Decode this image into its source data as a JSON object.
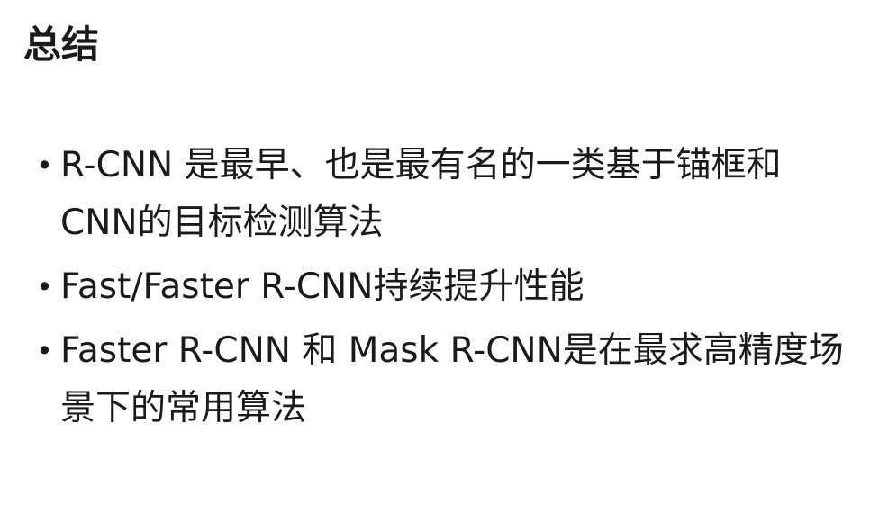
{
  "slide": {
    "title": "总结",
    "bullet_glyph": "•",
    "bullets": [
      {
        "text": "R-CNN 是最早、也是最有名的一类基于锚框和CNN的目标检测算法"
      },
      {
        "text": "Fast/Faster R-CNN持续提升性能"
      },
      {
        "text": "Faster R-CNN 和 Mask R-CNN是在最求高精度场景下的常用算法"
      }
    ]
  }
}
